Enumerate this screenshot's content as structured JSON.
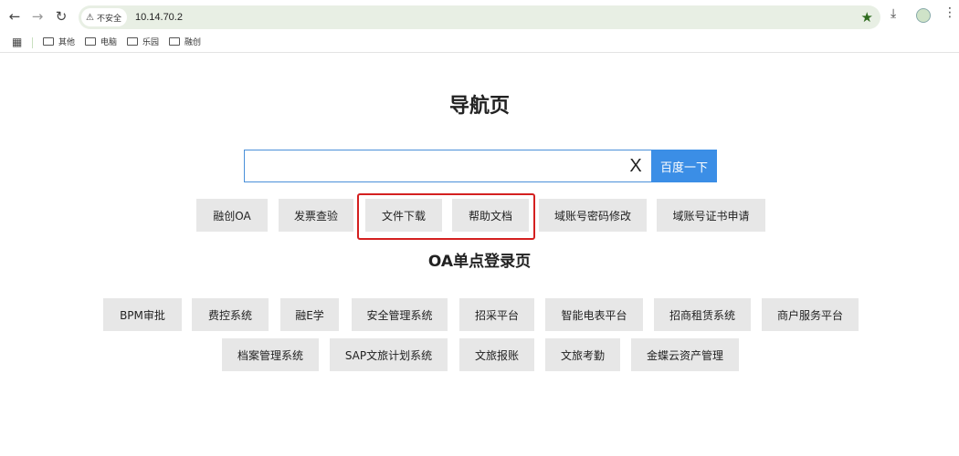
{
  "browser": {
    "security_label": "不安全",
    "url": "10.14.70.2"
  },
  "bookmarks": [
    {
      "label": "其他"
    },
    {
      "label": "电脑"
    },
    {
      "label": "乐园"
    },
    {
      "label": "融创"
    }
  ],
  "page": {
    "title": "导航页",
    "search": {
      "value": "",
      "clear_label": "X",
      "button_label": "百度一下"
    },
    "quick_links": [
      {
        "label": "融创OA"
      },
      {
        "label": "发票查验"
      },
      {
        "label": "文件下载"
      },
      {
        "label": "帮助文档"
      },
      {
        "label": "域账号密码修改"
      },
      {
        "label": "域账号证书申请"
      }
    ],
    "oa_title": "OA单点登录页",
    "oa_row1": [
      {
        "label": "BPM审批"
      },
      {
        "label": "费控系统"
      },
      {
        "label": "融E学"
      },
      {
        "label": "安全管理系统"
      },
      {
        "label": "招采平台"
      },
      {
        "label": "智能电表平台"
      },
      {
        "label": "招商租赁系统"
      },
      {
        "label": "商户服务平台"
      }
    ],
    "oa_row2": [
      {
        "label": "档案管理系统"
      },
      {
        "label": "SAP文旅计划系统"
      },
      {
        "label": "文旅报账"
      },
      {
        "label": "文旅考勤"
      },
      {
        "label": "金蝶云资产管理"
      }
    ]
  },
  "colors": {
    "accent": "#3b8ee6",
    "highlight": "#d42020",
    "pill_bg": "#e7e7e7"
  }
}
